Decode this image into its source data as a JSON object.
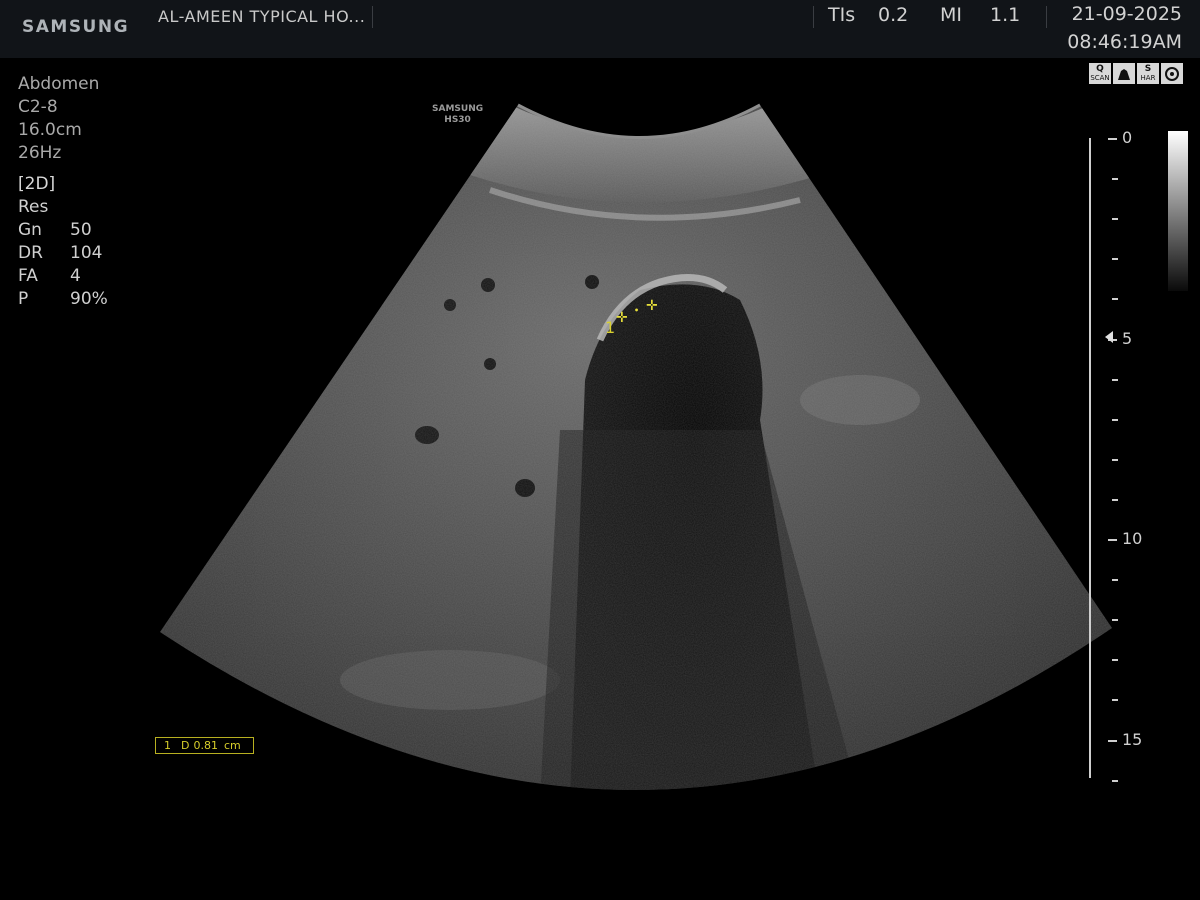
{
  "header": {
    "brand": "SAMSUNG",
    "hospital": "AL-AMEEN TYPICAL HO...",
    "tis_label": "TIs",
    "tis_value": "0.2",
    "mi_label": "MI",
    "mi_value": "1.1",
    "date": "21-09-2025",
    "time": "08:46:19AM"
  },
  "status_icons": [
    {
      "top": "Q",
      "bottom": "SCAN",
      "icon": "qscan-icon"
    },
    {
      "top": "",
      "bottom": "",
      "icon": "probe-icon"
    },
    {
      "top": "S",
      "bottom": "HAR",
      "icon": "harmonic-icon"
    },
    {
      "top": "",
      "bottom": "",
      "icon": "settings-icon"
    }
  ],
  "params": {
    "preset": "Abdomen",
    "probe": "C2-8",
    "depth": "16.0cm",
    "frame_rate": "26Hz",
    "mode": "[2D]",
    "res": "Res",
    "gn_label": "Gn",
    "gn_value": "50",
    "dr_label": "DR",
    "dr_value": "104",
    "fa_label": "FA",
    "fa_value": "4",
    "p_label": "P",
    "p_value": "90%"
  },
  "watermark": {
    "line1": "SAMSUNG",
    "line2": "HS30"
  },
  "measurement": {
    "index": "1",
    "type": "D",
    "value": "0.81",
    "unit": "cm",
    "marker_label": "1"
  },
  "depth_scale": {
    "labels": [
      "0",
      "5",
      "10",
      "15"
    ]
  },
  "colors": {
    "caliper": "#e8e03a",
    "background": "#000000",
    "header_bg": "#111418"
  }
}
